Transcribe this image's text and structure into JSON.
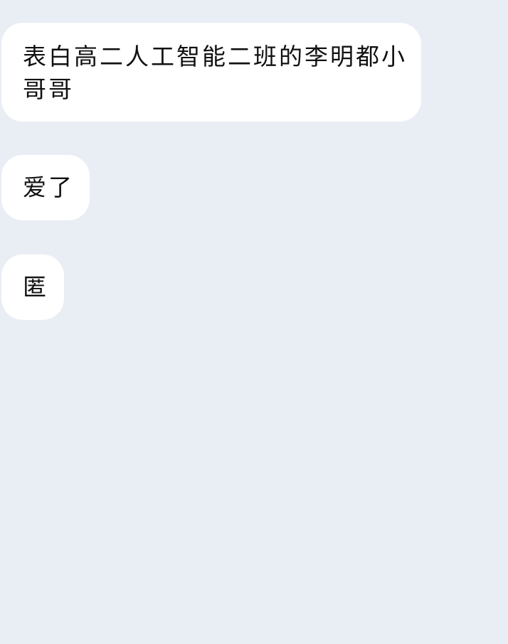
{
  "messages": [
    {
      "text": "表白高二人工智能二班的李明都小哥哥"
    },
    {
      "text": "爱了"
    },
    {
      "text": "匿"
    }
  ]
}
